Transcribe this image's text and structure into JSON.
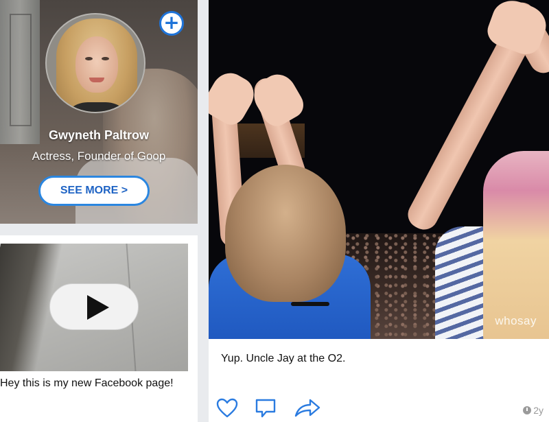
{
  "profile": {
    "name": "Gwyneth Paltrow",
    "title": "Actress, Founder of Goop",
    "follow_icon": "plus-circle-icon",
    "see_more_label": "SEE MORE >"
  },
  "video_post": {
    "play_icon": "play-icon",
    "caption": "Hey this is my new Facebook page!"
  },
  "photo_post": {
    "watermark": "whosay",
    "caption": "Yup. Uncle Jay at the O2.",
    "actions": [
      {
        "name": "like",
        "icon": "heart-icon"
      },
      {
        "name": "comment",
        "icon": "speech-bubble-icon"
      },
      {
        "name": "share",
        "icon": "share-arrow-icon"
      }
    ],
    "timestamp": "2y"
  },
  "colors": {
    "accent": "#1e73d8",
    "page_bg": "#e9ebee"
  }
}
